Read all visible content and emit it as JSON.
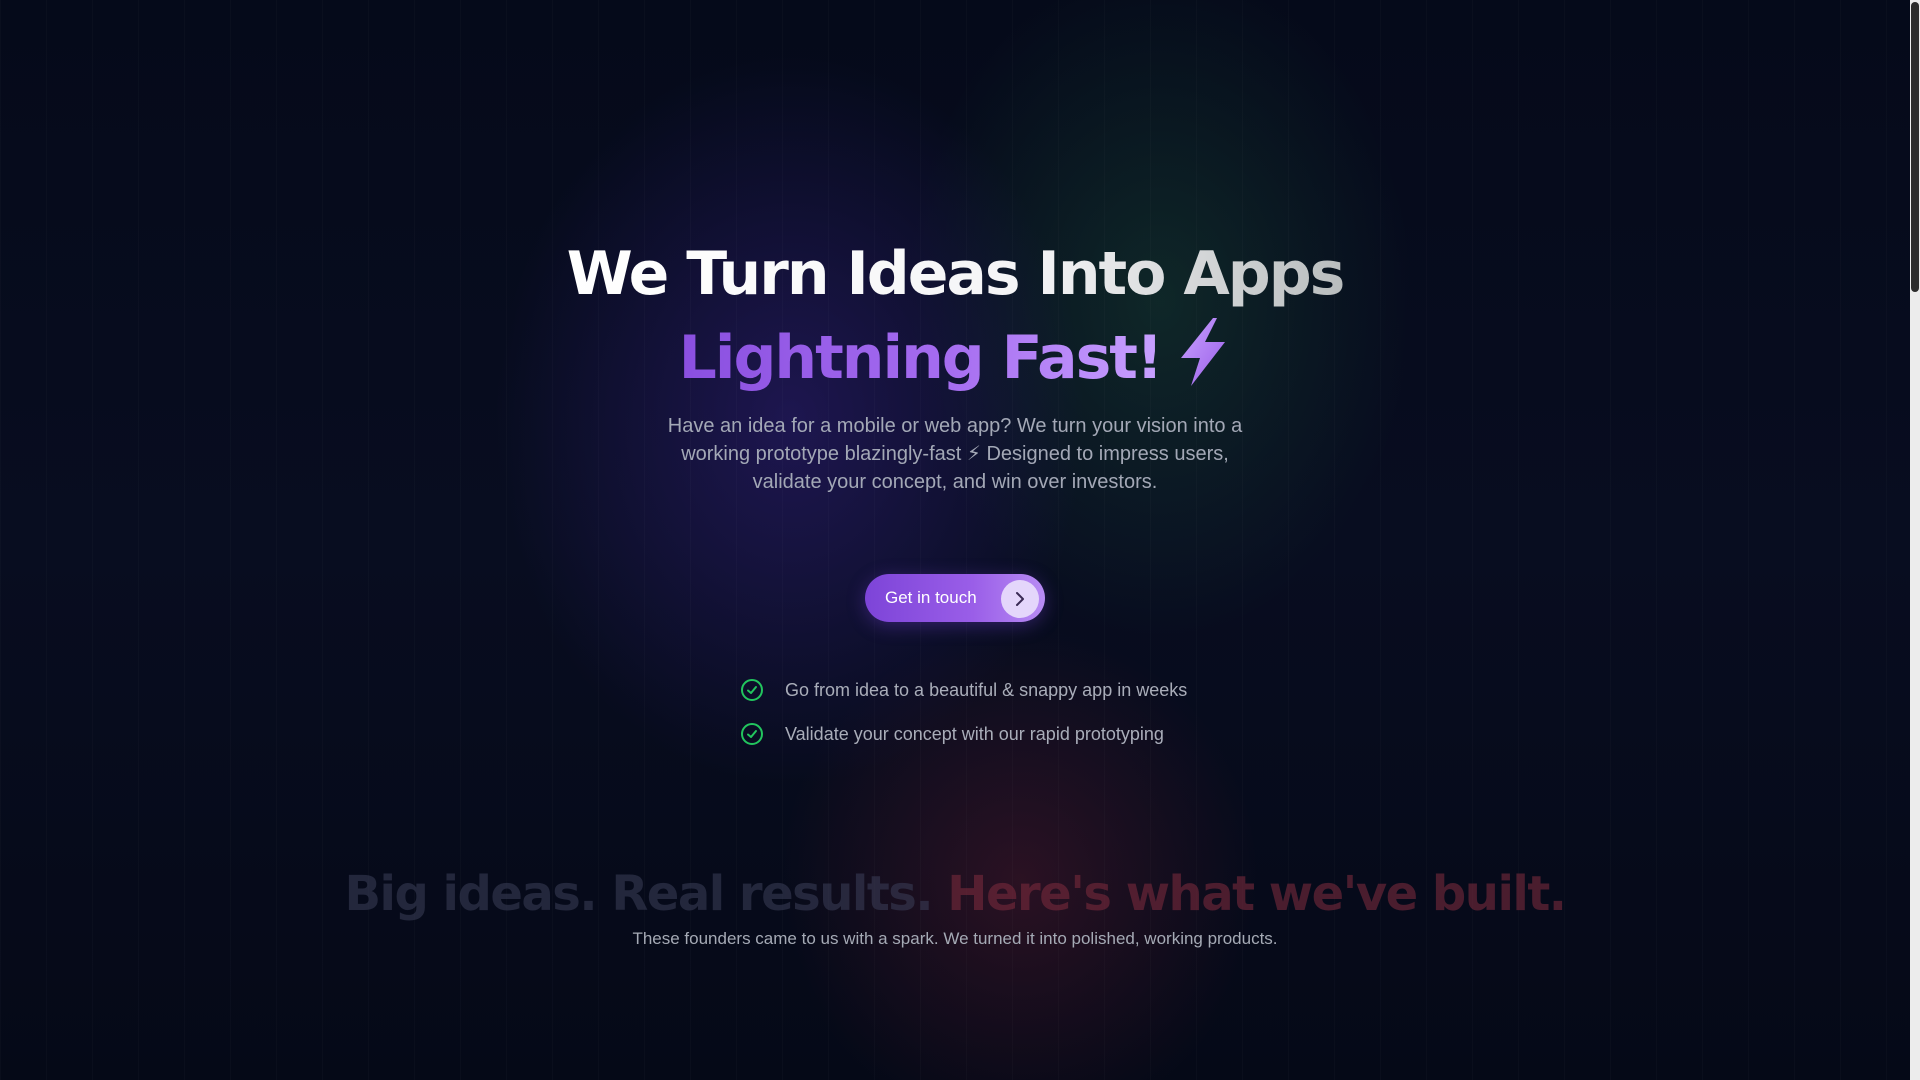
{
  "hero": {
    "title_line1": "We Turn Ideas Into Apps",
    "title_line2": "Lightning Fast!",
    "title_icon": "lightning-bolt-icon",
    "description": "Have an idea for a mobile or web app? We turn your vision into a working prototype blazingly-fast ⚡ Designed to impress users, validate your concept, and win over investors.",
    "cta_label": "Get in touch",
    "cta_icon": "chevron-right-icon"
  },
  "features": [
    {
      "icon": "check-circle-icon",
      "text": "Go from idea to a beautiful & snappy app in weeks"
    },
    {
      "icon": "check-circle-icon",
      "text": "Validate your concept with our rapid prototyping"
    }
  ],
  "showcase": {
    "title_part1": "Big ideas. Real results.",
    "title_part2": "Here's what we've built.",
    "subtitle": "These founders came to us with a spark. We turned it into polished, working products."
  },
  "colors": {
    "background": "#060a18",
    "accent_purple": "#9a5ee8",
    "check_green": "#22c55e",
    "text_muted": "#a3a8b6"
  }
}
